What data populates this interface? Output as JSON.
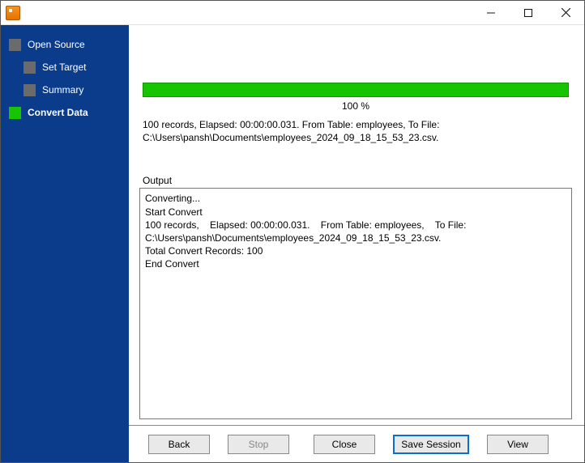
{
  "window": {
    "title": ""
  },
  "sidebar": {
    "steps": [
      {
        "label": "Open Source"
      },
      {
        "label": "Set Target"
      },
      {
        "label": "Summary"
      },
      {
        "label": "Convert Data"
      }
    ]
  },
  "progress": {
    "percent_label": "100 %"
  },
  "status": {
    "line1": "100 records,    Elapsed: 00:00:00.031.    From Table: employees,    To File:",
    "line2": "C:\\Users\\pansh\\Documents\\employees_2024_09_18_15_53_23.csv."
  },
  "output": {
    "label": "Output",
    "text": "Converting...\nStart Convert\n100 records,    Elapsed: 00:00:00.031.    From Table: employees,    To File: C:\\Users\\pansh\\Documents\\employees_2024_09_18_15_53_23.csv.\nTotal Convert Records: 100\nEnd Convert"
  },
  "buttons": {
    "back": "Back",
    "stop": "Stop",
    "close": "Close",
    "save_session": "Save Session",
    "view": "View"
  }
}
